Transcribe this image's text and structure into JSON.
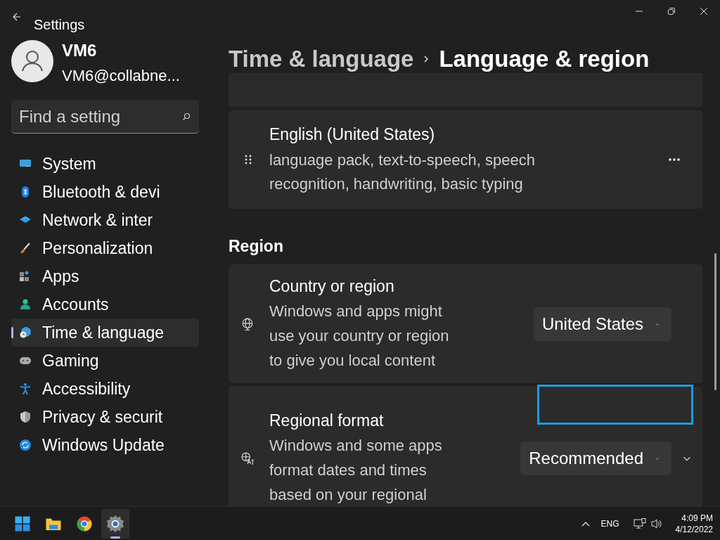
{
  "window": {
    "title": "Settings"
  },
  "account": {
    "name": "VM6",
    "email": "VM6@collabne..."
  },
  "search": {
    "placeholder": "Find a setting"
  },
  "nav": [
    {
      "kind": "system",
      "label": "System",
      "selected": false
    },
    {
      "kind": "bluetooth",
      "label": "Bluetooth & devi",
      "selected": false
    },
    {
      "kind": "network",
      "label": "Network & inter",
      "selected": false
    },
    {
      "kind": "personalization",
      "label": "Personalization",
      "selected": false
    },
    {
      "kind": "apps",
      "label": "Apps",
      "selected": false
    },
    {
      "kind": "accounts",
      "label": "Accounts",
      "selected": false
    },
    {
      "kind": "time",
      "label": "Time & language",
      "selected": true
    },
    {
      "kind": "gaming",
      "label": "Gaming",
      "selected": false
    },
    {
      "kind": "accessibility",
      "label": "Accessibility",
      "selected": false
    },
    {
      "kind": "privacy",
      "label": "Privacy & securit",
      "selected": false
    },
    {
      "kind": "update",
      "label": "Windows Update",
      "selected": false
    }
  ],
  "breadcrumb": {
    "parent": "Time & language",
    "current": "Language & region"
  },
  "languages": [
    {
      "name": "English (United States)",
      "features": "language pack, text-to-speech, speech\nrecognition, handwriting, basic typing"
    }
  ],
  "region": {
    "heading": "Region",
    "settings": [
      {
        "kind": "globe",
        "title": "Country or region",
        "description": "Windows and apps might\nuse your country or region\nto give you local content",
        "value": "United States",
        "expandable": false,
        "focused": false
      },
      {
        "kind": "format",
        "title": "Regional format",
        "description": "Windows and some apps\nformat dates and times\nbased on your regional",
        "value": "Recommended",
        "expandable": true,
        "focused": true
      }
    ]
  },
  "taskbar": {
    "apps": [
      {
        "kind": "start",
        "selected": false
      },
      {
        "kind": "explorer",
        "selected": false
      },
      {
        "kind": "browser",
        "selected": false
      },
      {
        "kind": "settings",
        "selected": true
      }
    ],
    "language": "ENG",
    "time": "4:09 PM",
    "date": "4/12/2022"
  }
}
